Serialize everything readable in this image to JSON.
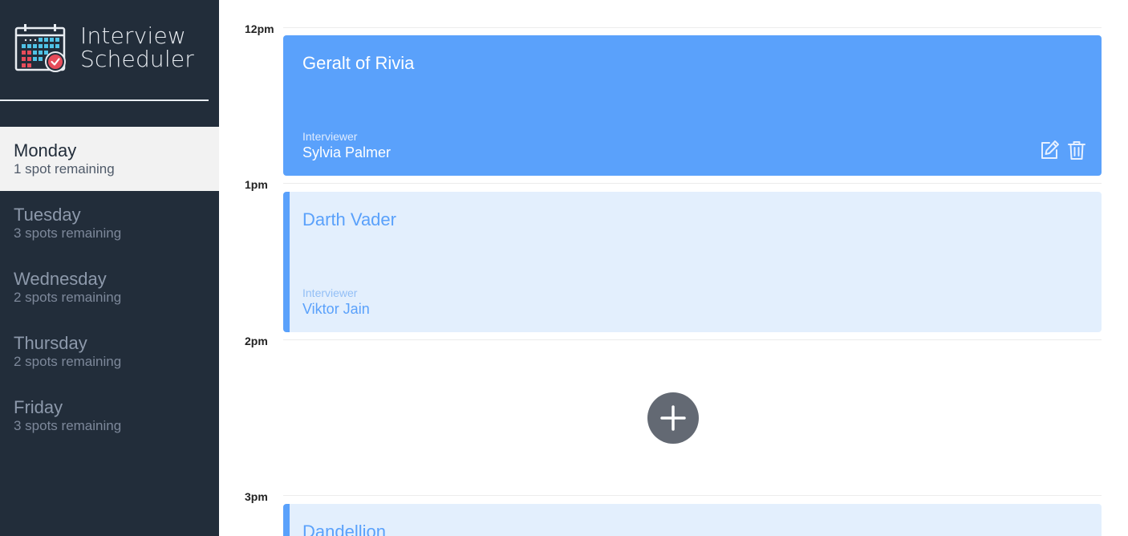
{
  "app": {
    "title_line1": "Interview",
    "title_line2": "Scheduler",
    "logo_icon": "calendar-check-icon"
  },
  "colors": {
    "sidebar_bg": "#222d3a",
    "accent_blue": "#5aa1fb",
    "empty_card_bg": "#e3effd",
    "add_button": "#636973",
    "selected_day_bg": "#f2f2f2"
  },
  "days": [
    {
      "name": "Monday",
      "spots": "1 spot remaining",
      "selected": true
    },
    {
      "name": "Tuesday",
      "spots": "3 spots remaining"
    },
    {
      "name": "Wednesday",
      "spots": "2 spots remaining"
    },
    {
      "name": "Thursday",
      "spots": "2 spots remaining"
    },
    {
      "name": "Friday",
      "spots": "3 spots remaining"
    }
  ],
  "schedule": {
    "times": [
      "12pm",
      "1pm",
      "2pm",
      "3pm"
    ],
    "appointments": [
      {
        "student": "Geralt of Rivia",
        "interviewer_label": "Interviewer",
        "interviewer": "Sylvia Palmer",
        "state": "hovered"
      },
      {
        "student": "Darth Vader",
        "interviewer_label": "Interviewer",
        "interviewer": "Viktor Jain",
        "state": "normal"
      },
      {
        "state": "empty",
        "action_icon": "plus-icon"
      },
      {
        "student": "Dandellion",
        "state": "normal"
      }
    ],
    "action_icons": [
      "edit-icon",
      "trash-icon"
    ]
  }
}
